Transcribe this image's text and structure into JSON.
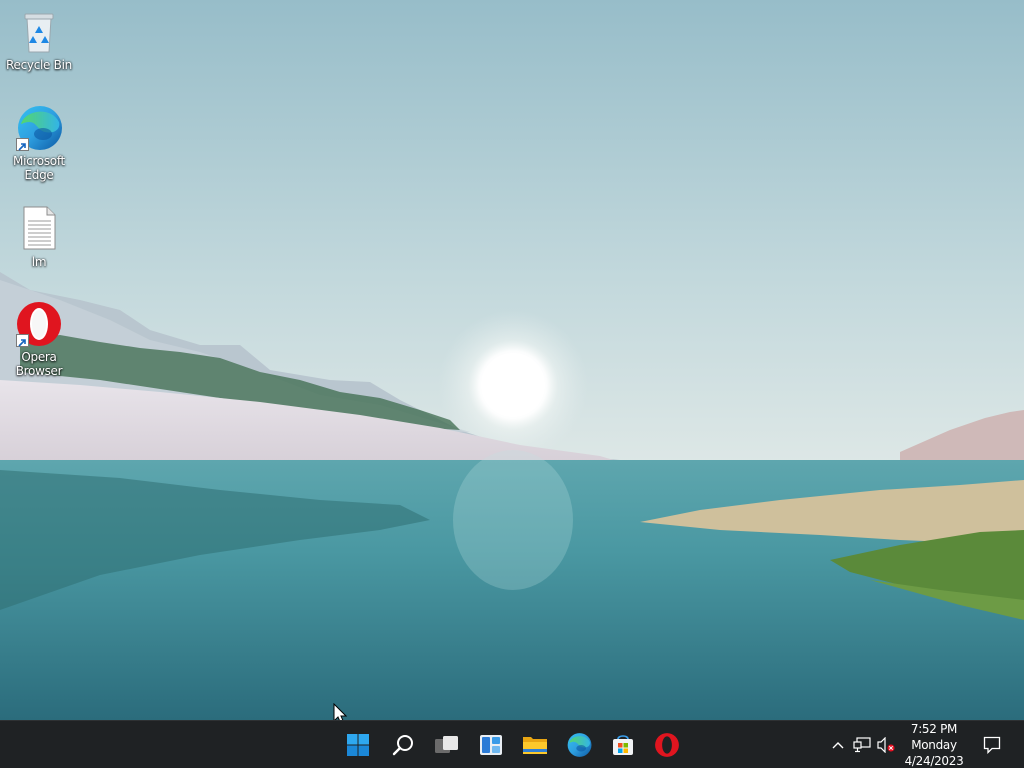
{
  "desktop": {
    "icons": [
      {
        "label": "Recycle Bin",
        "icon": "recycle-bin-icon"
      },
      {
        "label": "Microsoft Edge",
        "icon": "edge-icon"
      },
      {
        "label": "lm",
        "icon": "text-file-icon"
      },
      {
        "label": "Opera Browser",
        "icon": "opera-icon"
      }
    ]
  },
  "taskbar": {
    "buttons": [
      {
        "name": "start",
        "icon": "windows-logo-icon"
      },
      {
        "name": "search",
        "icon": "search-icon"
      },
      {
        "name": "task-view",
        "icon": "task-view-icon"
      },
      {
        "name": "widgets",
        "icon": "widgets-icon"
      },
      {
        "name": "file-explorer",
        "icon": "folder-icon"
      },
      {
        "name": "edge",
        "icon": "edge-icon"
      },
      {
        "name": "store",
        "icon": "store-icon"
      },
      {
        "name": "opera",
        "icon": "opera-icon"
      }
    ],
    "tray": {
      "chevron": "chevron-up-icon",
      "network": "network-icon",
      "volume": "volume-muted-icon",
      "notifications": "notification-icon"
    },
    "clock": {
      "time": "7:52 PM",
      "day": "Monday",
      "date": "4/24/2023"
    }
  },
  "colors": {
    "taskbar_bg": "#1f2224",
    "windows_blue": "#0078d4",
    "opera_red": "#e0151f"
  }
}
